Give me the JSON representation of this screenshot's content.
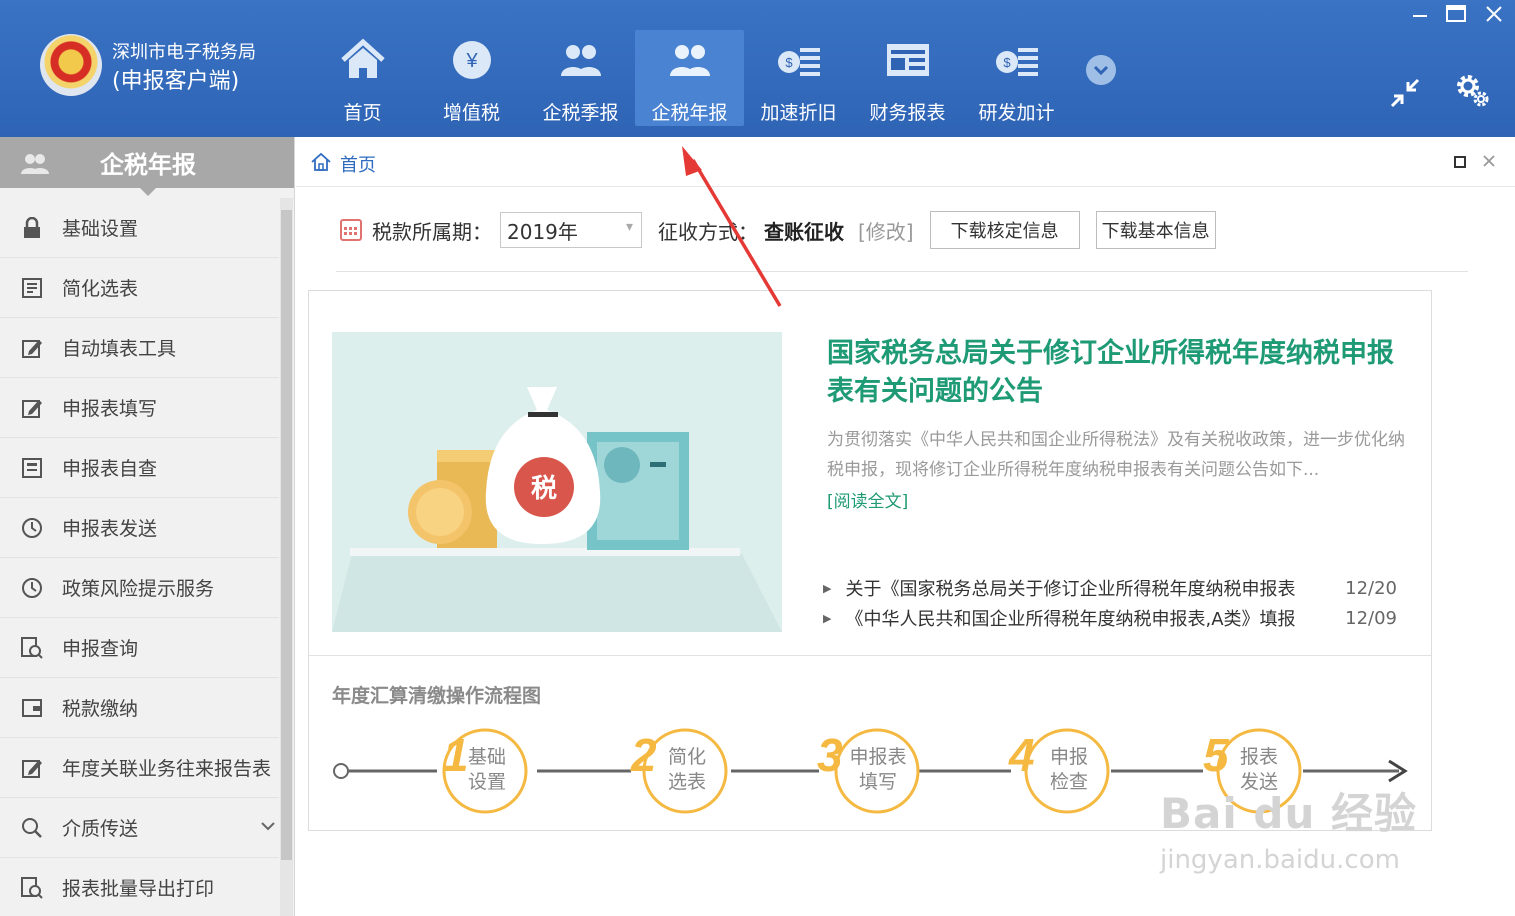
{
  "header": {
    "brand_line1": "深圳市电子税务局",
    "brand_line2": "(申报客户端)",
    "nav": [
      {
        "label": "首页",
        "icon": "home-icon"
      },
      {
        "label": "增值税",
        "icon": "yuan-coin-icon"
      },
      {
        "label": "企税季报",
        "icon": "people-icon"
      },
      {
        "label": "企税年报",
        "icon": "people-icon"
      },
      {
        "label": "加速折旧",
        "icon": "money-stack-icon"
      },
      {
        "label": "财务报表",
        "icon": "report-board-icon"
      },
      {
        "label": "研发加计",
        "icon": "money-stack-icon"
      }
    ],
    "active_nav": "企税年报",
    "accent_color": "#2f64b5"
  },
  "sidebar": {
    "title": "企税年报",
    "items": [
      {
        "label": "基础设置",
        "icon": "lock-icon"
      },
      {
        "label": "简化选表",
        "icon": "document-list-icon"
      },
      {
        "label": "自动填表工具",
        "icon": "edit-icon"
      },
      {
        "label": "申报表填写",
        "icon": "edit-icon"
      },
      {
        "label": "申报表自查",
        "icon": "form-check-icon"
      },
      {
        "label": "申报表发送",
        "icon": "send-clock-icon"
      },
      {
        "label": "政策风险提示服务",
        "icon": "clock-icon"
      },
      {
        "label": "申报查询",
        "icon": "search-document-icon"
      },
      {
        "label": "税款缴纳",
        "icon": "wallet-icon"
      },
      {
        "label": "年度关联业务往来报告表",
        "icon": "edit-icon"
      },
      {
        "label": "介质传送",
        "icon": "search-icon"
      },
      {
        "label": "报表批量导出打印",
        "icon": "search-document-icon"
      }
    ]
  },
  "breadcrumb": {
    "label": "首页"
  },
  "filter": {
    "period_label": "税款所属期：",
    "year_value": "2019年",
    "method_label": "征收方式：",
    "method_value": "查账征收",
    "edit_label": "[修改]",
    "btn_download_verify": "下载核定信息",
    "btn_download_basic": "下载基本信息"
  },
  "news": {
    "banner_tax_char": "税",
    "title": "国家税务总局关于修订企业所得税年度纳税申报表有关问题的公告",
    "summary": "为贯彻落实《中华人民共和国企业所得税法》及有关税收政策，进一步优化纳税申报，现将修订企业所得税年度纳税申报表有关问题公告如下...",
    "read_more": "[阅读全文]",
    "list": [
      {
        "text": "关于《国家税务总局关于修订企业所得税年度纳税申报表",
        "date": "12/20"
      },
      {
        "text": "《中华人民共和国企业所得税年度纳税申报表,A类》填报",
        "date": "12/09"
      }
    ],
    "title_color": "#1e9a74"
  },
  "flow": {
    "title": "年度汇算清缴操作流程图",
    "steps": [
      {
        "num": "1",
        "line1": "基础",
        "line2": "设置"
      },
      {
        "num": "2",
        "line1": "简化",
        "line2": "选表"
      },
      {
        "num": "3",
        "line1": "申报表",
        "line2": "填写"
      },
      {
        "num": "4",
        "line1": "申报",
        "line2": "检查"
      },
      {
        "num": "5",
        "line1": "报表",
        "line2": "发送"
      }
    ],
    "step_color": "#f5b942"
  },
  "watermark": {
    "line1": "Bai du 经验",
    "line2": "jingyan.baidu.com"
  }
}
